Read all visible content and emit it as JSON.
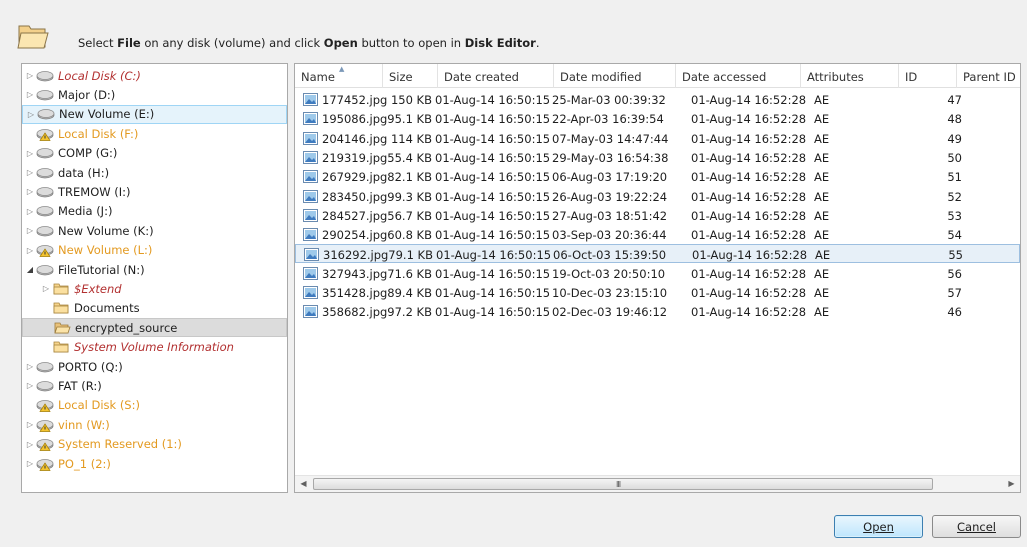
{
  "header": {
    "instruction_part1": "Select ",
    "instruction_bold1": "File",
    "instruction_part2": " on any disk (volume) and click ",
    "instruction_bold2": "Open",
    "instruction_part3": " button to open in ",
    "instruction_bold3": "Disk Editor",
    "instruction_part4": "."
  },
  "tree": {
    "items": [
      {
        "label": "Local Disk (C:)",
        "style": "red",
        "icon": "disk-icon",
        "expander": "collapsed",
        "indent": 0
      },
      {
        "label": "Major (D:)",
        "style": "normal",
        "icon": "disk-icon",
        "expander": "collapsed",
        "indent": 0
      },
      {
        "label": "New Volume (E:)",
        "style": "normal",
        "icon": "disk-icon",
        "expander": "collapsed",
        "indent": 0,
        "state": "hover"
      },
      {
        "label": "Local Disk (F:)",
        "style": "orange",
        "icon": "disk-warning-icon",
        "expander": "none",
        "indent": 0
      },
      {
        "label": "COMP (G:)",
        "style": "normal",
        "icon": "disk-icon",
        "expander": "collapsed",
        "indent": 0
      },
      {
        "label": "data (H:)",
        "style": "normal",
        "icon": "disk-icon",
        "expander": "collapsed",
        "indent": 0
      },
      {
        "label": "TREMOW (I:)",
        "style": "normal",
        "icon": "disk-icon",
        "expander": "collapsed",
        "indent": 0
      },
      {
        "label": "Media (J:)",
        "style": "normal",
        "icon": "disk-icon",
        "expander": "collapsed",
        "indent": 0
      },
      {
        "label": "New Volume (K:)",
        "style": "normal",
        "icon": "disk-icon",
        "expander": "collapsed",
        "indent": 0
      },
      {
        "label": "New Volume (L:)",
        "style": "orange",
        "icon": "disk-warning-icon",
        "expander": "collapsed",
        "indent": 0
      },
      {
        "label": "FileTutorial (N:)",
        "style": "normal",
        "icon": "disk-icon",
        "expander": "expanded",
        "indent": 0
      },
      {
        "label": "$Extend",
        "style": "red",
        "icon": "folder-icon",
        "expander": "collapsed",
        "indent": 1
      },
      {
        "label": "Documents",
        "style": "normal",
        "icon": "folder-icon",
        "expander": "none",
        "indent": 1
      },
      {
        "label": "encrypted_source",
        "style": "normal",
        "icon": "folder-open-icon",
        "expander": "none",
        "indent": 1,
        "state": "selected"
      },
      {
        "label": "System Volume Information",
        "style": "red",
        "icon": "folder-icon",
        "expander": "none",
        "indent": 1
      },
      {
        "label": "PORTO (Q:)",
        "style": "normal",
        "icon": "disk-icon",
        "expander": "collapsed",
        "indent": 0
      },
      {
        "label": "FAT (R:)",
        "style": "normal",
        "icon": "disk-icon",
        "expander": "collapsed",
        "indent": 0
      },
      {
        "label": "Local Disk (S:)",
        "style": "orange",
        "icon": "disk-warning-icon",
        "expander": "none",
        "indent": 0
      },
      {
        "label": "vinn (W:)",
        "style": "orange",
        "icon": "disk-warning-icon",
        "expander": "collapsed",
        "indent": 0
      },
      {
        "label": "System Reserved (1:)",
        "style": "orange",
        "icon": "disk-warning-icon",
        "expander": "collapsed",
        "indent": 0
      },
      {
        "label": "PO_1 (2:)",
        "style": "orange",
        "icon": "disk-warning-icon",
        "expander": "collapsed",
        "indent": 0
      }
    ]
  },
  "list": {
    "columns": [
      "Name",
      "Size",
      "Date created",
      "Date modified",
      "Date accessed",
      "Attributes",
      "ID",
      "Parent ID"
    ],
    "rows": [
      {
        "name": "177452.jpg",
        "size": "150 KB",
        "created": "01-Aug-14 16:50:15",
        "modified": "25-Mar-03 00:39:32",
        "accessed": "01-Aug-14 16:52:28",
        "attributes": "AE",
        "id": "47",
        "parent_id": ""
      },
      {
        "name": "195086.jpg",
        "size": "95.1 KB",
        "created": "01-Aug-14 16:50:15",
        "modified": "22-Apr-03 16:39:54",
        "accessed": "01-Aug-14 16:52:28",
        "attributes": "AE",
        "id": "48",
        "parent_id": ""
      },
      {
        "name": "204146.jpg",
        "size": "114 KB",
        "created": "01-Aug-14 16:50:15",
        "modified": "07-May-03 14:47:44",
        "accessed": "01-Aug-14 16:52:28",
        "attributes": "AE",
        "id": "49",
        "parent_id": ""
      },
      {
        "name": "219319.jpg",
        "size": "55.4 KB",
        "created": "01-Aug-14 16:50:15",
        "modified": "29-May-03 16:54:38",
        "accessed": "01-Aug-14 16:52:28",
        "attributes": "AE",
        "id": "50",
        "parent_id": ""
      },
      {
        "name": "267929.jpg",
        "size": "82.1 KB",
        "created": "01-Aug-14 16:50:15",
        "modified": "06-Aug-03 17:19:20",
        "accessed": "01-Aug-14 16:52:28",
        "attributes": "AE",
        "id": "51",
        "parent_id": ""
      },
      {
        "name": "283450.jpg",
        "size": "99.3 KB",
        "created": "01-Aug-14 16:50:15",
        "modified": "26-Aug-03 19:22:24",
        "accessed": "01-Aug-14 16:52:28",
        "attributes": "AE",
        "id": "52",
        "parent_id": ""
      },
      {
        "name": "284527.jpg",
        "size": "56.7 KB",
        "created": "01-Aug-14 16:50:15",
        "modified": "27-Aug-03 18:51:42",
        "accessed": "01-Aug-14 16:52:28",
        "attributes": "AE",
        "id": "53",
        "parent_id": ""
      },
      {
        "name": "290254.jpg",
        "size": "60.8 KB",
        "created": "01-Aug-14 16:50:15",
        "modified": "03-Sep-03 20:36:44",
        "accessed": "01-Aug-14 16:52:28",
        "attributes": "AE",
        "id": "54",
        "parent_id": ""
      },
      {
        "name": "316292.jpg",
        "size": "79.1 KB",
        "created": "01-Aug-14 16:50:15",
        "modified": "06-Oct-03 15:39:50",
        "accessed": "01-Aug-14 16:52:28",
        "attributes": "AE",
        "id": "55",
        "parent_id": "",
        "selected": true
      },
      {
        "name": "327943.jpg",
        "size": "71.6 KB",
        "created": "01-Aug-14 16:50:15",
        "modified": "19-Oct-03 20:50:10",
        "accessed": "01-Aug-14 16:52:28",
        "attributes": "AE",
        "id": "56",
        "parent_id": ""
      },
      {
        "name": "351428.jpg",
        "size": "89.4 KB",
        "created": "01-Aug-14 16:50:15",
        "modified": "10-Dec-03 23:15:10",
        "accessed": "01-Aug-14 16:52:28",
        "attributes": "AE",
        "id": "57",
        "parent_id": ""
      },
      {
        "name": "358682.jpg",
        "size": "97.2 KB",
        "created": "01-Aug-14 16:50:15",
        "modified": "02-Dec-03 19:46:12",
        "accessed": "01-Aug-14 16:52:28",
        "attributes": "AE",
        "id": "46",
        "parent_id": ""
      }
    ]
  },
  "scrollbar": {
    "grip": "III"
  },
  "buttons": {
    "open_label": "Open",
    "cancel_label": "Cancel"
  },
  "colors": {
    "red_label": "#b23030",
    "orange_label": "#e39a21",
    "selection": "#e7f0f8",
    "primary_button_border": "#3c7fb1"
  }
}
